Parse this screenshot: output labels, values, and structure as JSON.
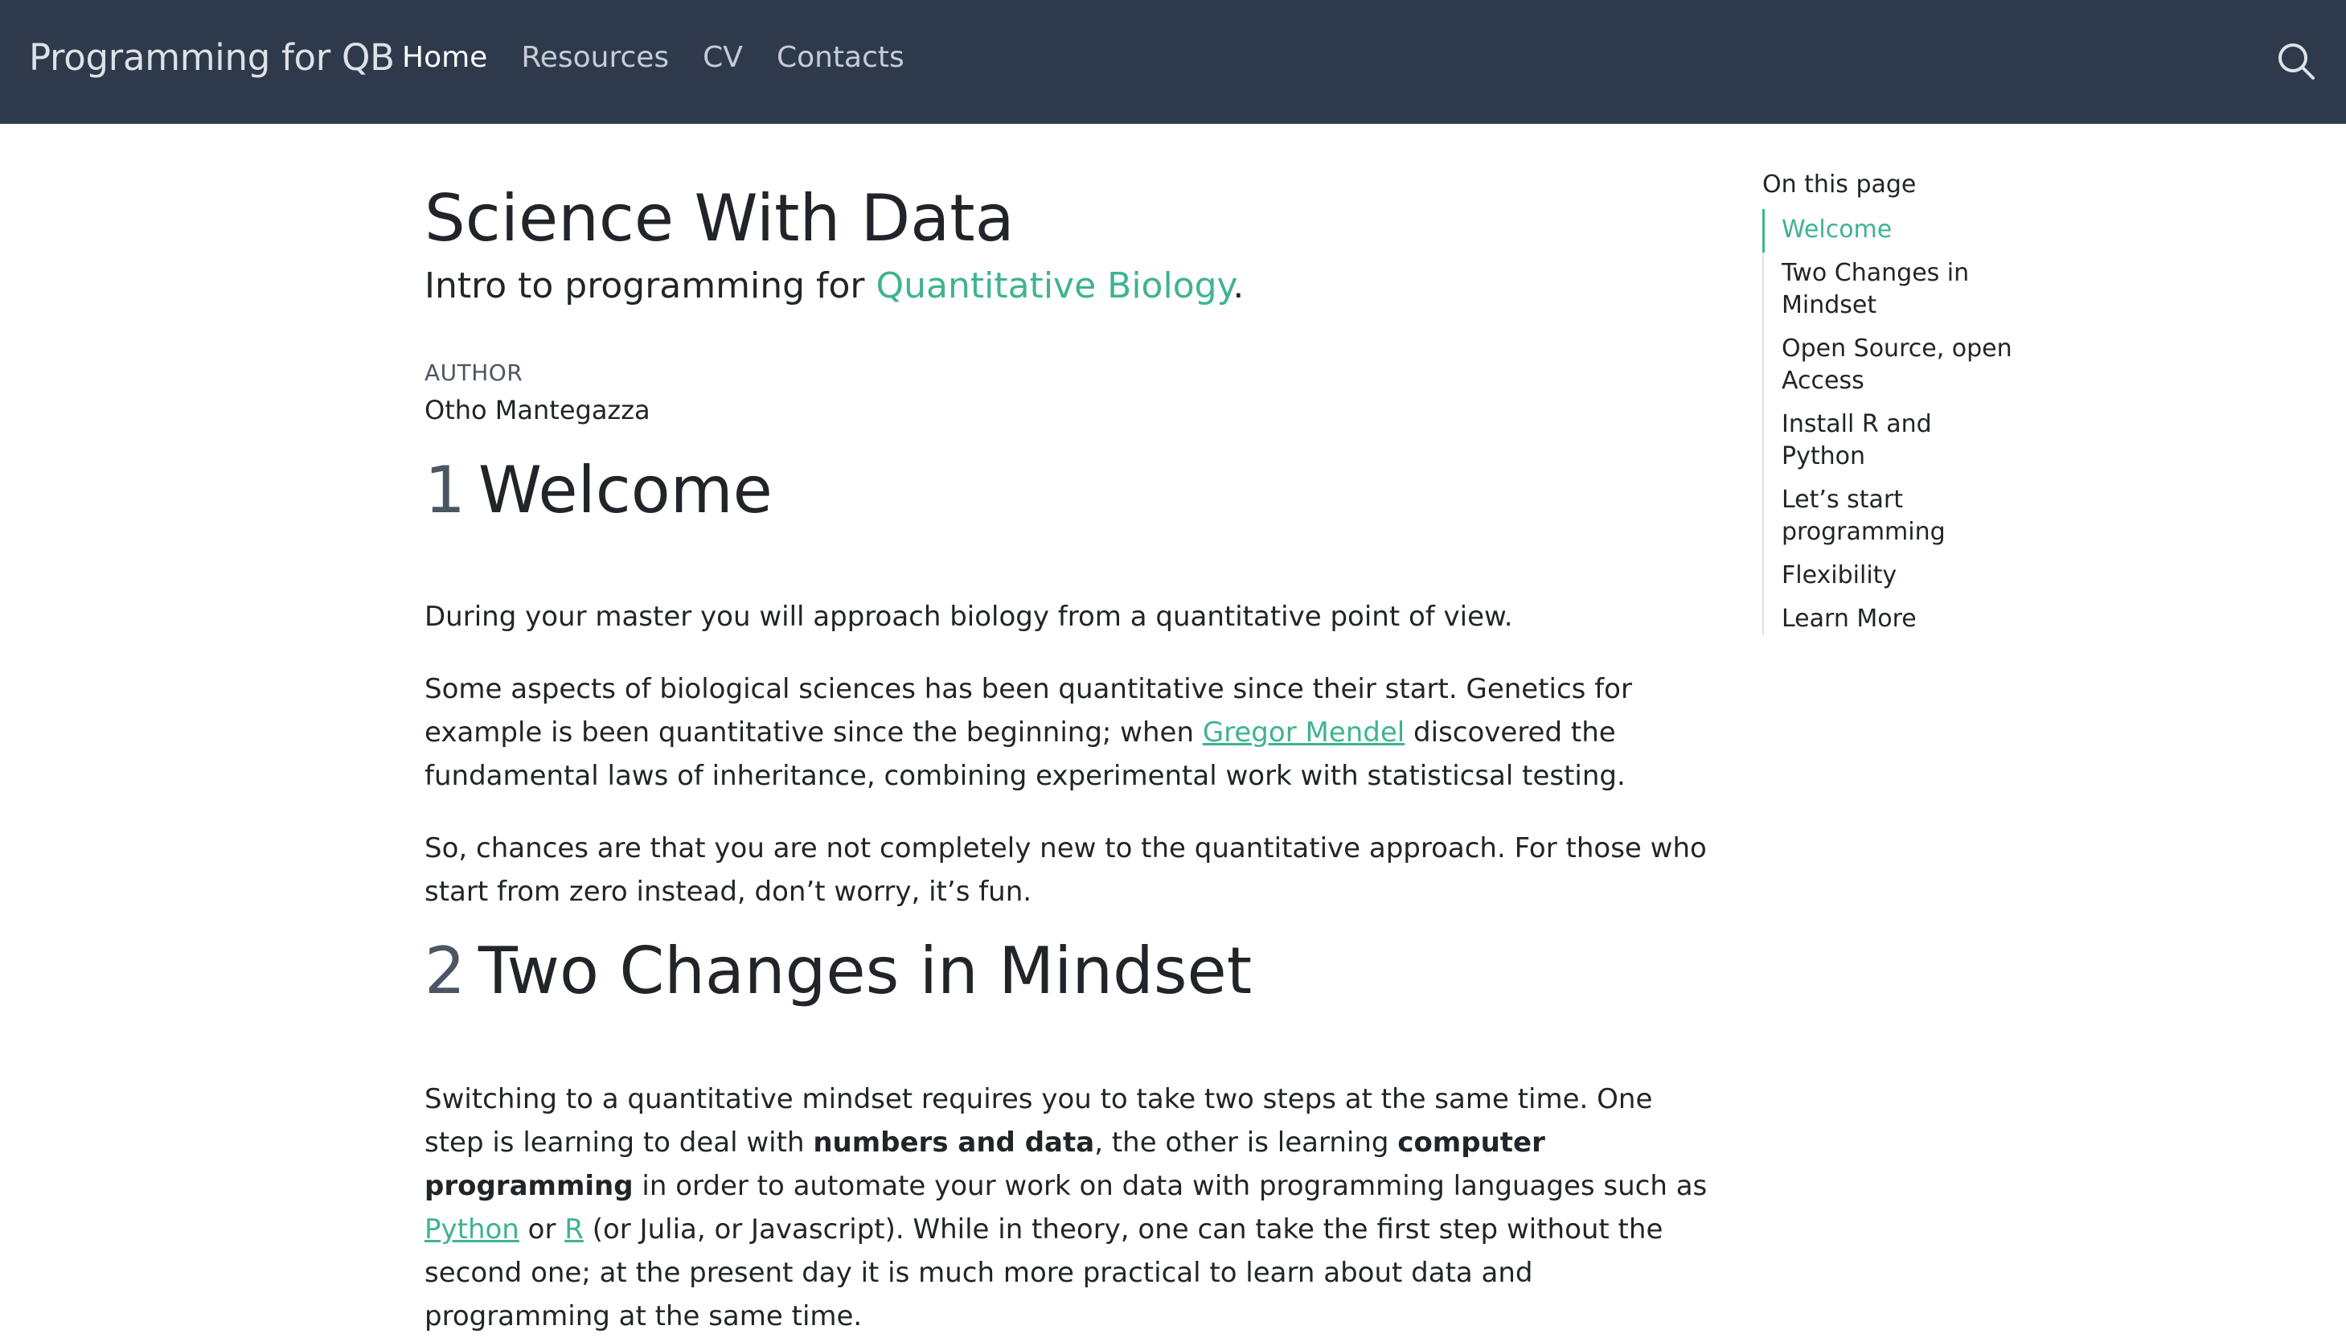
{
  "navbar": {
    "brand": "Programming for QB",
    "links": [
      {
        "label": "Home",
        "active": true
      },
      {
        "label": "Resources",
        "active": false
      },
      {
        "label": "CV",
        "active": false
      },
      {
        "label": "Contacts",
        "active": false
      }
    ],
    "search_icon": "search-icon"
  },
  "page": {
    "title": "Science With Data",
    "subtitle_prefix": "Intro to programming for ",
    "subtitle_link": "Quantitative Biology",
    "subtitle_suffix": ".",
    "author_label": "AUTHOR",
    "author_name": "Otho Mantegazza"
  },
  "sections": [
    {
      "number": "1",
      "title": "Welcome",
      "paragraphs": {
        "p1": "During your master you will approach biology from a quantitative point of view.",
        "p2_a": "Some aspects of biological sciences has been quantitative since their start. Genetics for example is been quantitative since the beginning; when ",
        "p2_link": "Gregor Mendel",
        "p2_b": " discovered the fundamental laws of inheritance, combining experimental work with statisticsal testing.",
        "p3": "So, chances are that you are not completely new to the quantitative approach. For those who start from zero instead, don’t worry, it’s fun."
      }
    },
    {
      "number": "2",
      "title": "Two Changes in Mindset",
      "paragraphs": {
        "p1_a": "Switching to a quantitative mindset requires you to take two steps at the same time. One step is learning to deal with ",
        "p1_bold1": "numbers and data",
        "p1_b": ", the other is learning ",
        "p1_bold2": "computer programming",
        "p1_c": " in order to automate your work on data with programming languages such as ",
        "p1_link1": "Python",
        "p1_d": " or ",
        "p1_link2": "R",
        "p1_e": " (or Julia, or Javascript). While in theory, one can take the first step without the second one; at the present day it is much more practical to learn about data and programming at the same time."
      }
    }
  ],
  "toc": {
    "title": "On this page",
    "items": [
      {
        "label": "Welcome",
        "active": true
      },
      {
        "label": "Two Changes in Mindset",
        "active": false
      },
      {
        "label": "Open Source, open Access",
        "active": false
      },
      {
        "label": "Install R and Python",
        "active": false
      },
      {
        "label": "Let’s start programming",
        "active": false
      },
      {
        "label": "Flexibility",
        "active": false
      },
      {
        "label": "Learn More",
        "active": false
      }
    ]
  },
  "colors": {
    "navbar_bg": "#2e3a4c",
    "accent": "#3fb391",
    "text": "#212529",
    "muted": "#4b5563"
  }
}
